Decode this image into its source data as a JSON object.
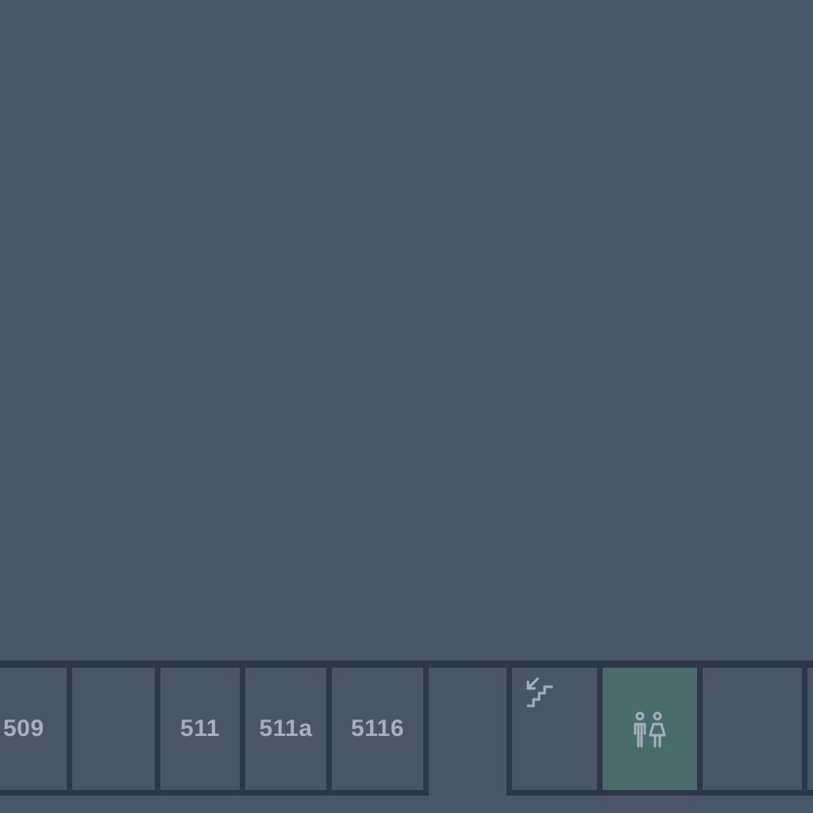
{
  "map": {
    "colors": {
      "background": "#4a5567",
      "wall": "#2d3748",
      "label": "#a7afbd",
      "restroom_fill": "#4a6b6b"
    },
    "rooms": [
      {
        "id": "room-509",
        "label": "509"
      },
      {
        "id": "room-blank-1",
        "label": ""
      },
      {
        "id": "room-511",
        "label": "511"
      },
      {
        "id": "room-511a",
        "label": "511a"
      },
      {
        "id": "room-5116",
        "label": "5116"
      },
      {
        "id": "corridor-gap",
        "label": ""
      },
      {
        "id": "room-stairs",
        "label": "",
        "icon": "stairs-down-icon"
      },
      {
        "id": "room-restroom",
        "label": "",
        "icon": "restroom-icon"
      },
      {
        "id": "room-blank-2",
        "label": ""
      }
    ]
  }
}
